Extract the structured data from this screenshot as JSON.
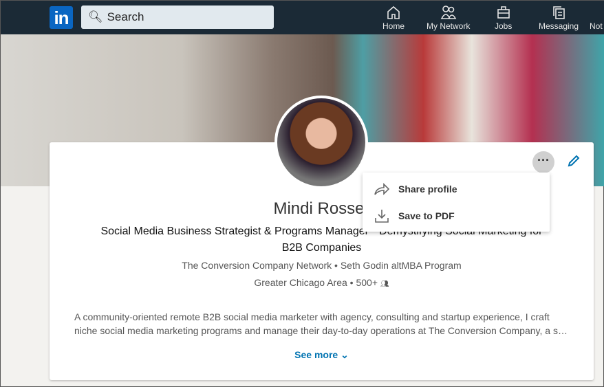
{
  "nav": {
    "search_placeholder": "Search",
    "items": [
      {
        "label": "Home",
        "icon": "home-icon"
      },
      {
        "label": "My Network",
        "icon": "network-icon"
      },
      {
        "label": "Jobs",
        "icon": "briefcase-icon"
      },
      {
        "label": "Messaging",
        "icon": "messaging-icon"
      },
      {
        "label": "Not",
        "icon": "bell-icon"
      }
    ]
  },
  "profile": {
    "name": "Mindi Rosser",
    "headline": "Social Media Business Strategist & Programs Manager * Demystifying Social Marketing for B2B Companies",
    "company": "The Conversion Company Network",
    "education": "Seth Godin altMBA Program",
    "location": "Greater Chicago Area",
    "connections": "500+",
    "about": "A community-oriented remote B2B social media marketer with agency, consulting and startup experience, I craft niche social media marketing programs and manage their day-to-day operations at The Conversion Company, a s…",
    "see_more": "See more"
  },
  "menu": {
    "items": [
      {
        "label": "Share profile",
        "icon": "share-icon"
      },
      {
        "label": "Save to PDF",
        "icon": "download-icon"
      }
    ]
  },
  "colors": {
    "nav_bg": "#1b2a36",
    "brand": "#0a66c2",
    "link": "#0073b1"
  }
}
